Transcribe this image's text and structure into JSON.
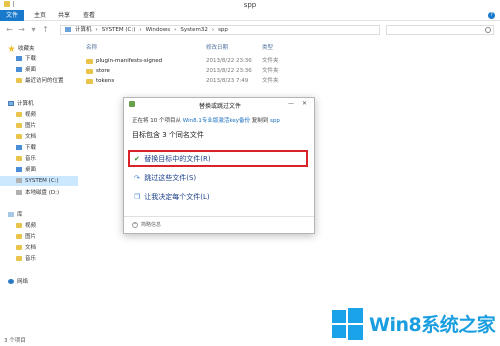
{
  "window": {
    "title": "spp"
  },
  "ribbon": {
    "file_tab": "文件",
    "tabs": [
      "主页",
      "共享",
      "查看"
    ]
  },
  "address": {
    "path": [
      "计算机",
      "SYSTEM (C:)",
      "Windows",
      "System32",
      "spp"
    ]
  },
  "nav": {
    "favorites": "收藏夹",
    "fav_items": [
      "下载",
      "桌面",
      "最近访问的位置"
    ],
    "computer": "计算机",
    "computer_items": [
      "视频",
      "图片",
      "文档",
      "下载",
      "音乐",
      "桌面",
      "SYSTEM (C:)",
      "本地磁盘 (D:)"
    ],
    "library": "库",
    "library_items": [
      "视频",
      "图片",
      "文档",
      "音乐"
    ],
    "network": "网络"
  },
  "filelist": {
    "columns": [
      "名称",
      "修改日期",
      "类型"
    ],
    "rows": [
      {
        "name": "plugin-manifests-signed",
        "date": "2013/8/22 23:36",
        "type": "文件夹"
      },
      {
        "name": "store",
        "date": "2013/8/22 23:36",
        "type": "文件夹"
      },
      {
        "name": "tokens",
        "date": "2013/8/23 7:49",
        "type": "文件夹"
      }
    ]
  },
  "status": {
    "item_count": "3 个项目"
  },
  "dialog": {
    "title": "替换或跳过文件",
    "line1_prefix": "正在将 10 个项目从",
    "line1_source": "Win8.1专业版激活key备份",
    "line1_mid": "复制到",
    "line1_dest": "spp",
    "heading": "目标包含 3 个同名文件",
    "choices": [
      "替换目标中的文件(R)",
      "跳过这些文件(S)",
      "让我决定每个文件(L)"
    ],
    "details": "简略信息"
  },
  "watermark": {
    "text": "Win8系统之家"
  }
}
